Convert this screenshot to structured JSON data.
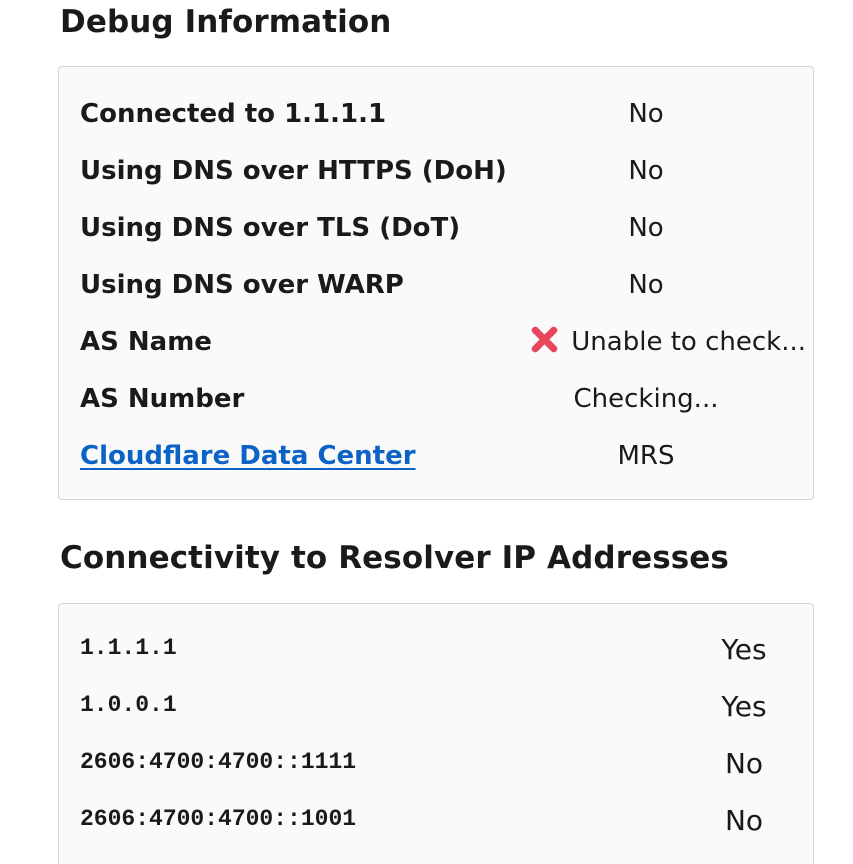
{
  "debug": {
    "title": "Debug Information",
    "rows": [
      {
        "label": "Connected to 1.1.1.1",
        "value": "No"
      },
      {
        "label": "Using DNS over HTTPS (DoH)",
        "value": "No"
      },
      {
        "label": "Using DNS over TLS (DoT)",
        "value": "No"
      },
      {
        "label": "Using DNS over WARP",
        "value": "No"
      },
      {
        "label": "AS Name",
        "value": "Unable to check...",
        "icon": "cross-mark-icon"
      },
      {
        "label": "AS Number",
        "value": "Checking..."
      },
      {
        "label": "Cloudflare Data Center",
        "value": "MRS",
        "link": true
      }
    ]
  },
  "connectivity": {
    "title": "Connectivity to Resolver IP Addresses",
    "rows": [
      {
        "address": "1.1.1.1",
        "value": "Yes"
      },
      {
        "address": "1.0.0.1",
        "value": "Yes"
      },
      {
        "address": "2606:4700:4700::1111",
        "value": "No"
      },
      {
        "address": "2606:4700:4700::1001",
        "value": "No"
      }
    ]
  },
  "colors": {
    "link": "#0b63c6",
    "error_icon": "#e8465c",
    "card_background": "#fafafa",
    "card_border": "#d6d6d6"
  }
}
